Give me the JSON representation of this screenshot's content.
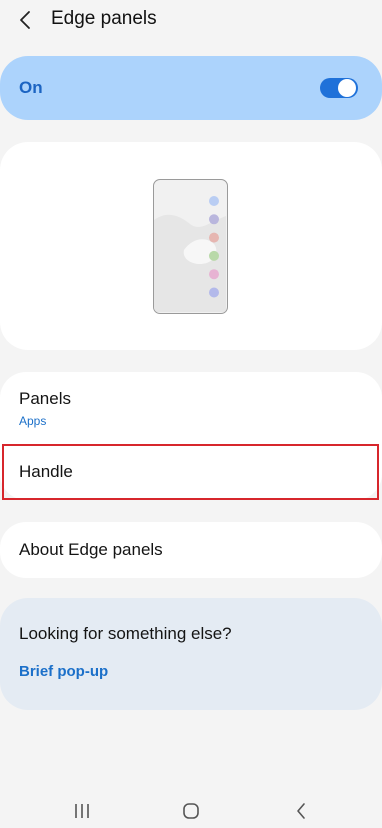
{
  "header": {
    "title": "Edge panels",
    "back_icon": "chevron-left-icon"
  },
  "master_switch": {
    "label": "On",
    "state": "on",
    "accent": "#1f71d9"
  },
  "preview": {
    "dot_colors": [
      "#b9cdf3",
      "#b9b6dd",
      "#e6b6b1",
      "#b9d9a9",
      "#e7b3d3",
      "#b3b9ea"
    ]
  },
  "list": {
    "panels": {
      "title": "Panels",
      "subtitle": "Apps"
    },
    "handle": {
      "title": "Handle",
      "highlighted": true
    },
    "about": {
      "title": "About Edge panels"
    }
  },
  "suggestion": {
    "question": "Looking for something else?",
    "link": "Brief pop-up"
  },
  "navbar": {
    "recents_icon": "recents-icon",
    "home_icon": "home-icon",
    "back_icon": "back-icon"
  }
}
